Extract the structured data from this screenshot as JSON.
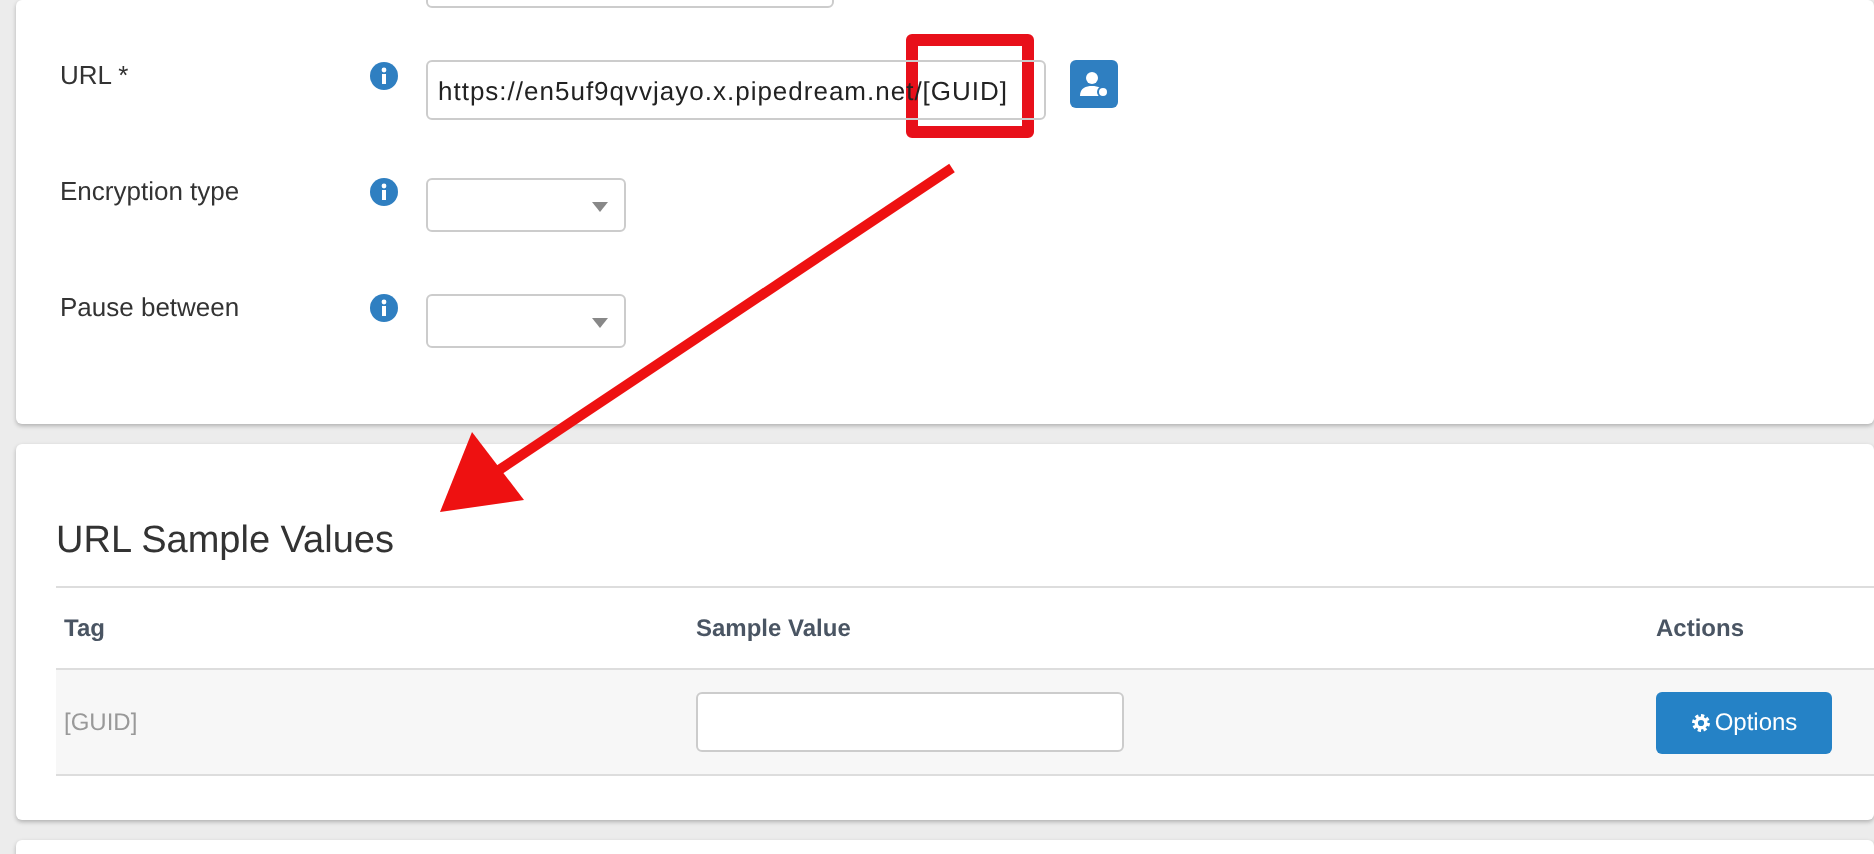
{
  "settings_form": {
    "fields": [
      {
        "kind": "text",
        "label": "URL *",
        "value": "https://en5uf9qvvjayo.x.pipedream.net/[GUID]"
      },
      {
        "kind": "select",
        "label": "Encryption type"
      },
      {
        "kind": "select",
        "label": "Pause between"
      }
    ]
  },
  "sample_values": {
    "title": "URL Sample Values",
    "columns": [
      "Tag",
      "Sample Value",
      "Actions"
    ],
    "rows": [
      {
        "tag": "[GUID]",
        "action": "Options"
      }
    ]
  }
}
